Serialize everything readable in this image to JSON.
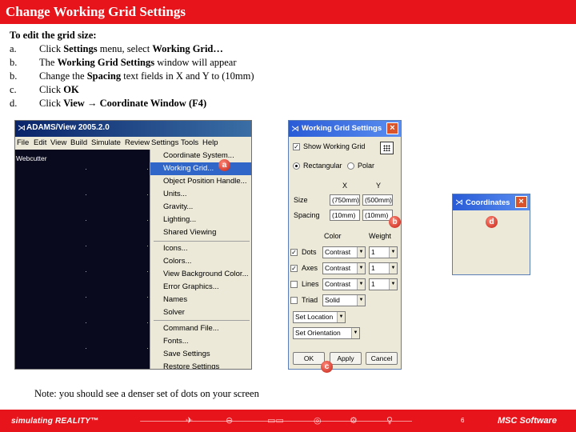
{
  "slide": {
    "title": "Change Working Grid Settings",
    "note": "Note: you should see a denser set of dots on your screen",
    "page_number": "6"
  },
  "instructions": {
    "heading": "To edit the grid size:",
    "steps": [
      {
        "letter": "a.",
        "parts": [
          "Click ",
          "Settings",
          " menu, select ",
          "Working Grid…"
        ]
      },
      {
        "letter": "b.",
        "parts": [
          "The ",
          "Working Grid Settings",
          " window will appear"
        ]
      },
      {
        "letter": "b.",
        "parts": [
          "Change the ",
          "Spacing",
          " text fields in X and Y to (10mm)"
        ]
      },
      {
        "letter": "c.",
        "parts": [
          "Click ",
          "OK"
        ]
      },
      {
        "letter": "d.",
        "parts": [
          "Click ",
          "View → Coordinate Window (F4)"
        ]
      }
    ]
  },
  "adams": {
    "title": "ADAMS/View 2005.2.0",
    "menubar": [
      "File",
      "Edit",
      "View",
      "Build",
      "Simulate",
      "Review",
      "Settings",
      "Tools",
      "Help"
    ],
    "canvas_label": "Webcutter",
    "settings_menu": [
      "Coordinate System...",
      "Working Grid...",
      "Object Position Handle...",
      "Units...",
      "Gravity...",
      "Lighting...",
      "Shared Viewing",
      "Icons...",
      "Colors...",
      "View Background Color...",
      "Error Graphics...",
      "Names",
      "Solver",
      "Command File...",
      "Fonts...",
      "Save Settings",
      "Restore Settings"
    ]
  },
  "wgs": {
    "title": "Working Grid Settings",
    "show_working_grid": "Show Working Grid",
    "rect_label": "Rectangular",
    "polar_label": "Polar",
    "col_x": "X",
    "col_y": "Y",
    "size_label": "Size",
    "size_x": "(750mm)",
    "size_y": "(500mm)",
    "spacing_label": "Spacing",
    "spacing_x": "(10mm)",
    "spacing_y": "(10mm)",
    "col_color": "Color",
    "col_weight": "Weight",
    "rows": [
      {
        "label": "Dots",
        "checked": true,
        "color": "Contrast",
        "weight": "1"
      },
      {
        "label": "Axes",
        "checked": true,
        "color": "Contrast",
        "weight": "1"
      },
      {
        "label": "Lines",
        "checked": false,
        "color": "Contrast",
        "weight": "1"
      },
      {
        "label": "Triad",
        "checked": false,
        "color": "Solid",
        "weight": ""
      }
    ],
    "set_location": "Set Location",
    "set_orientation": "Set Orientation",
    "ok": "OK",
    "apply": "Apply",
    "cancel": "Cancel"
  },
  "coords": {
    "title": "Coordinates"
  },
  "callouts": {
    "a": "a",
    "b": "b",
    "c": "c",
    "d": "d"
  },
  "footer": {
    "brand": "simulating REALITY™",
    "logo": "MSC Software"
  },
  "colors": {
    "brand_red": "#e8141b",
    "menu_highlight": "#2f66c8",
    "canvas_bg": "#0a0a1e"
  }
}
